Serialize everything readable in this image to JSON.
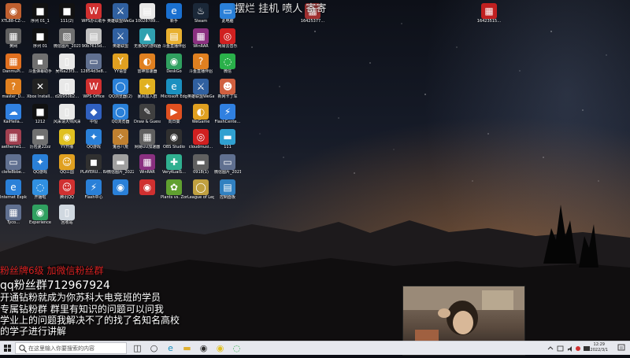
{
  "desktop": {
    "icons": [
      {
        "label": "XTL88-CZ-…",
        "glyph": "◉",
        "color": "#c06030"
      },
      {
        "label": "序列 01_1",
        "glyph": "■",
        "color": "#111111"
      },
      {
        "label": "111(2)",
        "glyph": "■",
        "color": "#111111"
      },
      {
        "label": "WPS办公助手",
        "glyph": "W",
        "color": "#d03030"
      },
      {
        "label": "英雄联盟WeGame版",
        "glyph": "⚔",
        "color": "#3060a0"
      },
      {
        "label": "10028789…",
        "glyph": "▤",
        "color": "#e8e8e8"
      },
      {
        "label": "新手",
        "glyph": "e",
        "color": "#1a70d0"
      },
      {
        "label": "Steam",
        "glyph": "♨",
        "color": "#1b2838"
      },
      {
        "label": "此电脑",
        "glyph": "▭",
        "color": "#2a80d8"
      },
      {
        "label": "黄网",
        "glyph": "▦",
        "color": "#606060"
      },
      {
        "label": "序列 01",
        "glyph": "■",
        "color": "#111111"
      },
      {
        "label": "微信图片_2021102…",
        "glyph": "▧",
        "color": "#707070"
      },
      {
        "label": "90b7615d…",
        "glyph": "▤",
        "color": "#c0c0c0"
      },
      {
        "label": "英雄联盟",
        "glyph": "⚔",
        "color": "#3060a0"
      },
      {
        "label": "无畏契约游戏器",
        "glyph": "▲",
        "color": "#30a0b0"
      },
      {
        "label": "斗鱼直播伴侣",
        "glyph": "▤",
        "color": "#e8b030"
      },
      {
        "label": "WinRAR",
        "glyph": "▦",
        "color": "#8a3080"
      },
      {
        "label": "网易云音乐",
        "glyph": "◎",
        "color": "#d02020"
      },
      {
        "label": "DanmuPi…",
        "glyph": "▦",
        "color": "#e07020"
      },
      {
        "label": "斗鱼弹幕助手",
        "glyph": "▪",
        "color": "#707070"
      },
      {
        "label": "吴f6a23f3…",
        "glyph": "▯",
        "color": "#e8e8e8"
      },
      {
        "label": "12854d3e8…",
        "glyph": "▭",
        "color": "#607090"
      },
      {
        "label": "YY语音",
        "glyph": "Y",
        "color": "#e0a020"
      },
      {
        "label": "雷神加速器",
        "glyph": "◐",
        "color": "#e08020"
      },
      {
        "label": "DeskGo",
        "glyph": "◉",
        "color": "#30a060"
      },
      {
        "label": "斗鱼直播伴侣",
        "glyph": "?",
        "color": "#e08020"
      },
      {
        "label": "微信",
        "glyph": "◌",
        "color": "#2ab04a"
      },
      {
        "label": "master_D…",
        "glyph": "?",
        "color": "#e08020"
      },
      {
        "label": "Xbox Install…",
        "glyph": "✕",
        "color": "#222222"
      },
      {
        "label": "d2b950b2…",
        "glyph": "▯",
        "color": "#e8e8e8"
      },
      {
        "label": "WPS Office",
        "glyph": "W",
        "color": "#d03030"
      },
      {
        "label": "QQ浏览器(2)",
        "glyph": "◯",
        "color": "#2a80d8"
      },
      {
        "label": "暴风加入群",
        "glyph": "✦",
        "color": "#e0b020"
      },
      {
        "label": "Microsoft Edge",
        "glyph": "e",
        "color": "#1a90c0"
      },
      {
        "label": "英雄联盟WeGame版",
        "glyph": "⚔",
        "color": "#3060a0"
      },
      {
        "label": "新网卡丁车",
        "glyph": "☻",
        "color": "#d06040"
      },
      {
        "label": "KaiHeila…",
        "glyph": "☁",
        "color": "#3080e0"
      },
      {
        "label": "1212",
        "glyph": "■",
        "color": "#111111"
      },
      {
        "label": "风采请大师风采个性化定制",
        "glyph": "▯",
        "color": "#e8e8e8"
      },
      {
        "label": "中恒",
        "glyph": "◆",
        "color": "#3060c0"
      },
      {
        "label": "QQ浏览器",
        "glyph": "◯",
        "color": "#2a80d8"
      },
      {
        "label": "Draw & Guess",
        "glyph": "✎",
        "color": "#404040"
      },
      {
        "label": "向日葵",
        "glyph": "▶",
        "color": "#e05020"
      },
      {
        "label": "WeGame",
        "glyph": "◐",
        "color": "#e0a020"
      },
      {
        "label": "FlashCente…",
        "glyph": "⚡",
        "color": "#3080e0"
      },
      {
        "label": "aetheme1…",
        "glyph": "▦",
        "color": "#a04050"
      },
      {
        "label": "历险夏22zz",
        "glyph": "▬",
        "color": "#707070"
      },
      {
        "label": "YY开播",
        "glyph": "◉",
        "color": "#e0c020"
      },
      {
        "label": "QQ游戏",
        "glyph": "✦",
        "color": "#2a80d8"
      },
      {
        "label": "鬼谷八荒",
        "glyph": "✧",
        "color": "#c08030"
      },
      {
        "label": "网易UU加速器",
        "glyph": "▦",
        "color": "#606060"
      },
      {
        "label": "OBS Studio",
        "glyph": "◉",
        "color": "#303030"
      },
      {
        "label": "cloudmusi…",
        "glyph": "◎",
        "color": "#d02020"
      },
      {
        "label": "111",
        "glyph": "▬",
        "color": "#30a0d0"
      },
      {
        "label": "clefe8bbe…",
        "glyph": "▭",
        "color": "#607090"
      },
      {
        "label": "QQ游戏",
        "glyph": "✦",
        "color": "#2a80d8"
      },
      {
        "label": "QQ三国",
        "glyph": "☺",
        "color": "#e0a020"
      },
      {
        "label": "PLAYERU… BATTLEGR…",
        "glyph": "◼",
        "color": "#303030"
      },
      {
        "label": "微信图片_2022011…",
        "glyph": "▬",
        "color": "#a0a0a0"
      },
      {
        "label": "WinRAR",
        "glyph": "▦",
        "color": "#8a3080"
      },
      {
        "label": "VeryKuaiS…",
        "glyph": "✚",
        "color": "#30b090"
      },
      {
        "label": "0918(1)",
        "glyph": "▬",
        "color": "#606060"
      },
      {
        "label": "微信图片_2021111…",
        "glyph": "▭",
        "color": "#607090"
      },
      {
        "label": "Internet Explorer",
        "glyph": "e",
        "color": "#2a80d8"
      },
      {
        "label": "开播啦",
        "glyph": "◌",
        "color": "#3090e0"
      },
      {
        "label": "腾讯QQ",
        "glyph": "☺",
        "color": "#d03030"
      },
      {
        "label": "Flash中心",
        "glyph": "⚡",
        "color": "#2a80d8"
      },
      {
        "label": "",
        "glyph": "◉",
        "color": "#2a80d8"
      },
      {
        "label": "",
        "glyph": "◉",
        "color": "#d03030"
      },
      {
        "label": "Plants vs. Zombies",
        "glyph": "✿",
        "color": "#60a030"
      },
      {
        "label": "League of Legends",
        "glyph": "◯",
        "color": "#c0a040"
      },
      {
        "label": "控制面板",
        "glyph": "▤",
        "color": "#3080c0"
      },
      {
        "label": "Tyco…",
        "glyph": "▦",
        "color": "#607090"
      },
      {
        "label": "Experience",
        "glyph": "◉",
        "color": "#30a060"
      },
      {
        "label": "回收站",
        "glyph": "▯",
        "color": "#d0d8e0"
      }
    ],
    "top_right_icons": [
      {
        "label": "16425377…",
        "glyph": "▦",
        "color": "#a03030"
      },
      {
        "label": "16423515…",
        "glyph": "▦",
        "color": "#c02020"
      }
    ]
  },
  "overlay": {
    "title": "摆烂 挂机 喷人 寄寄",
    "fan_line1": "粉丝牌6级 加微信粉丝群",
    "fan_line2": "qq粉丝群712967924",
    "ad_line1": "开通钻粉就成为你苏科大电竞班的学员",
    "ad_line2": "专属钻粉群 群里有知识的问题可以问我",
    "ad_line3": "学业上的问题我解决不了的找了名知名高校",
    "ad_line4": "的学子进行讲解"
  },
  "taskbar": {
    "search_placeholder": "在这里输入你要搜索的内容",
    "time": "12:29",
    "date": "2022/3/1",
    "pinned": [
      {
        "name": "task-view-icon",
        "glyph": "◫",
        "color": "#333333"
      },
      {
        "name": "cortana-icon",
        "glyph": "○",
        "color": "#333333"
      },
      {
        "name": "edge-icon",
        "glyph": "e",
        "color": "#1a90c0"
      },
      {
        "name": "file-explorer-icon",
        "glyph": "▬",
        "color": "#e0b030"
      },
      {
        "name": "obs-icon",
        "glyph": "◉",
        "color": "#303030"
      },
      {
        "name": "yy-icon",
        "glyph": "◉",
        "color": "#e0c020"
      },
      {
        "name": "wechat-icon",
        "glyph": "◌",
        "color": "#2ab04a"
      }
    ]
  }
}
